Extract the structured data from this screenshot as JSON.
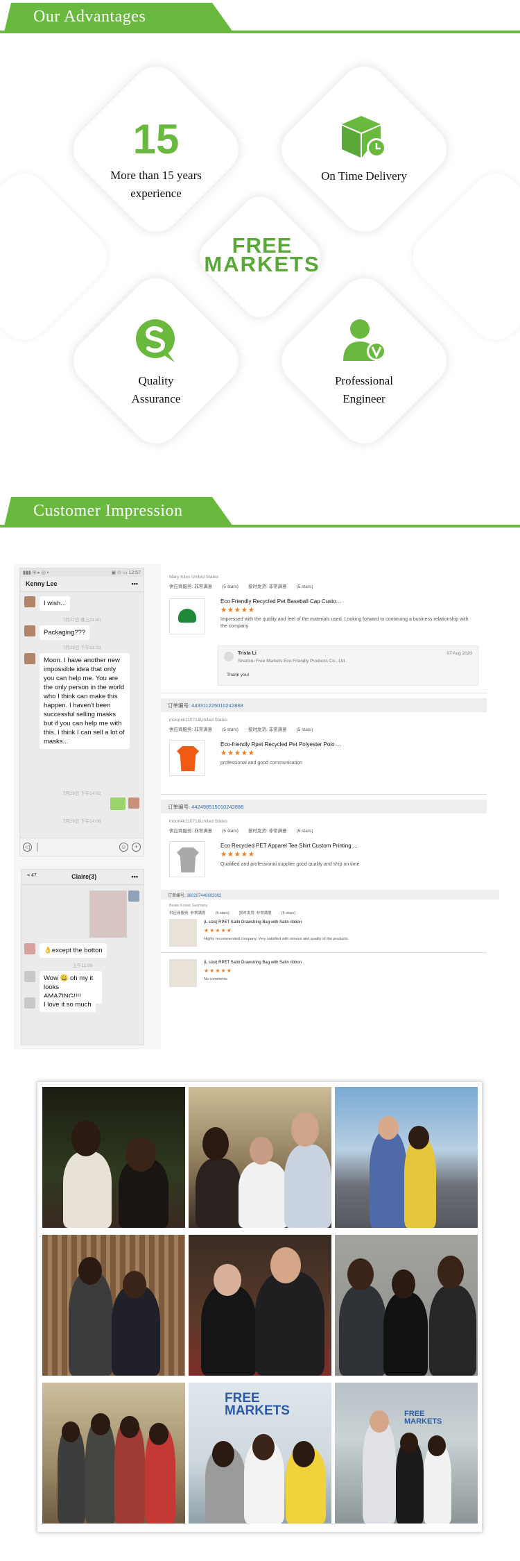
{
  "sections": {
    "advantages_title": "Our Advantages",
    "impression_title": "Customer Impression"
  },
  "colors": {
    "brand_green": "#6ab93f",
    "link_blue": "#2f6fb3",
    "star_orange": "#f07b1e"
  },
  "advantages": {
    "experience": {
      "number": "15",
      "line1": "More than 15 years",
      "line2": "experience"
    },
    "delivery": {
      "label": "On Time Delivery",
      "icon": "package-clock-icon"
    },
    "quality": {
      "line1": "Quality",
      "line2": "Assurance",
      "icon": "quality-s-icon"
    },
    "engineer": {
      "line1": "Professional",
      "line2": "Engineer",
      "icon": "engineer-person-icon"
    },
    "logo": {
      "line1": "FREE",
      "line2": "MARKETS"
    }
  },
  "chat1": {
    "contact": "Kenny Lee",
    "more": "•••",
    "status_left": "▮▮▮ ✉ ▸ ◎ •",
    "status_right": "▣ ⊙ ▭ 12:57",
    "messages": [
      {
        "text": "I wish..."
      },
      {
        "time": "7月27日 晚上23:40"
      },
      {
        "text": "Packaging???"
      },
      {
        "time": "7月29日 下午13:33"
      },
      {
        "text": "Moon.  I have another new impossible idea that only you can help me.  You are the only person in the world who I think can make this happen.  I haven't been successful selling masks but if you can help me with this, I think I can sell a lot of masks..."
      },
      {
        "time": "7月29日 下午14:02"
      },
      {
        "time": "7月29日 下午14:06"
      }
    ]
  },
  "chat2": {
    "back": "< 47",
    "contact": "Claire(3)",
    "more": "•••",
    "messages": [
      {
        "text": "👌except the botton"
      },
      {
        "time": "上午11:08"
      },
      {
        "text": "Wow 😀 oh my it looks AMAZING!!!!"
      },
      {
        "text": "I love it so much"
      }
    ]
  },
  "orders": {
    "buyer1": "Mary Kiles United States",
    "ratings_label_a": "供应商服务: 非常满意",
    "ratings_label_b": "(5 stars)",
    "ratings_label_c": "按时发货: 非常满意",
    "ratings_label_d": "(5 stars)",
    "items": [
      {
        "title": "Eco Friendly Recycled Pet Baseball Cap Custo...",
        "stars": "★★★★★",
        "comment": "Impressed with the quality and feel of the materials used. Looking forward to continuing a business relationship with the company"
      },
      {
        "title": "Eco-friendly Rpet Recycled Pet Polyester Polo ...",
        "stars": "★★★★★",
        "comment": "professional and good communication"
      },
      {
        "title": "Eco Recycled PET Apparel Tee Shirt Custom Printing ...",
        "stars": "★★★★★",
        "comment": "Qualified and professional supplier good quality and ship on time"
      },
      {
        "title": "(L size) RPET Satin Drawstring Bag with Satin ribbon",
        "stars": "★★★★★",
        "comment": "Highly recommended company. Very satisfied with service and quality of the products."
      },
      {
        "title": "(L size) RPET Satin Drawstring Bag with Satin ribbon",
        "stars": "★★★★★",
        "comment": "No comments"
      }
    ],
    "reply": {
      "name": "Trista Li",
      "company": "Shantou Free Markets Eco Friendly Products Co., Ltd.",
      "date": "07 Aug 2020",
      "text": "Thank you!"
    },
    "order_label": "订单编号: ",
    "order_no_1": "443311225010242888",
    "order_no_2": "442498515010242888",
    "order_no_3": "360207446602002",
    "buyer2": "moon4k11071&United States",
    "buyer3": "moon4k11071&United States",
    "buyer4": "Beate Kosek Germany"
  },
  "photos": [
    {
      "desc": "photo-1"
    },
    {
      "desc": "photo-2"
    },
    {
      "desc": "photo-3"
    },
    {
      "desc": "photo-4"
    },
    {
      "desc": "photo-5"
    },
    {
      "desc": "photo-6"
    },
    {
      "desc": "photo-7"
    },
    {
      "desc": "photo-8"
    },
    {
      "desc": "photo-9"
    }
  ],
  "photo_text": {
    "logo_line1": "FREE",
    "logo_line2": "MARKETS"
  }
}
